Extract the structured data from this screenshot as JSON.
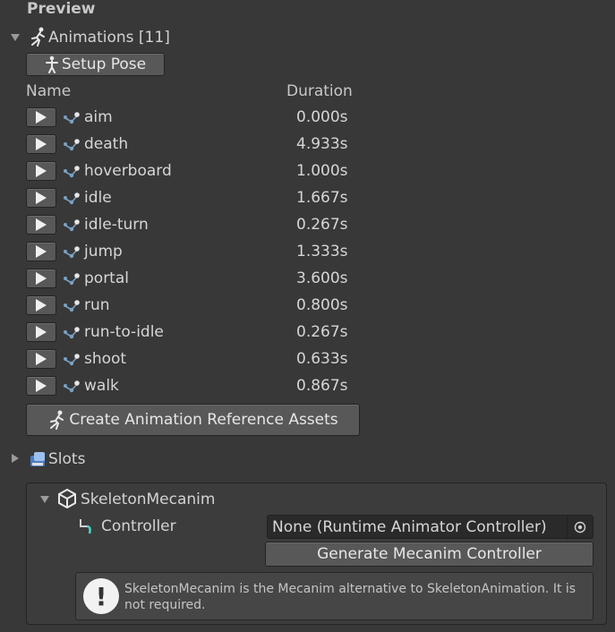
{
  "preview": {
    "title": "Preview"
  },
  "animations": {
    "header": "Animations [11]",
    "setup_pose_label": "Setup Pose",
    "col_name": "Name",
    "col_duration": "Duration",
    "items": [
      {
        "name": "aim",
        "duration": "0.000s"
      },
      {
        "name": "death",
        "duration": "4.933s"
      },
      {
        "name": "hoverboard",
        "duration": "1.000s"
      },
      {
        "name": "idle",
        "duration": "1.667s"
      },
      {
        "name": "idle-turn",
        "duration": "0.267s"
      },
      {
        "name": "jump",
        "duration": "1.333s"
      },
      {
        "name": "portal",
        "duration": "3.600s"
      },
      {
        "name": "run",
        "duration": "0.800s"
      },
      {
        "name": "run-to-idle",
        "duration": "0.267s"
      },
      {
        "name": "shoot",
        "duration": "0.633s"
      },
      {
        "name": "walk",
        "duration": "0.867s"
      }
    ],
    "create_ref_label": "Create Animation Reference Assets"
  },
  "slots": {
    "header": "Slots"
  },
  "mecanim": {
    "header": "SkeletonMecanim",
    "controller_label": "Controller",
    "controller_value": "None (Runtime Animator Controller)",
    "generate_label": "Generate Mecanim Controller",
    "help_text": "SkeletonMecanim is the Mecanim alternative to SkeletonAnimation. It is not required."
  },
  "colors": {
    "background": "#383838",
    "button": "#585858",
    "field": "#2a2a2a",
    "accent": "#4fd1c5"
  },
  "icons": {
    "animations": "running-figure-icon",
    "setup_pose": "standing-figure-icon",
    "row": "bone-icon",
    "slots": "slots-icon",
    "mecanim": "unity-cube-icon",
    "controller": "controller-icon",
    "picker": "object-picker-icon",
    "help": "exclamation-icon"
  }
}
